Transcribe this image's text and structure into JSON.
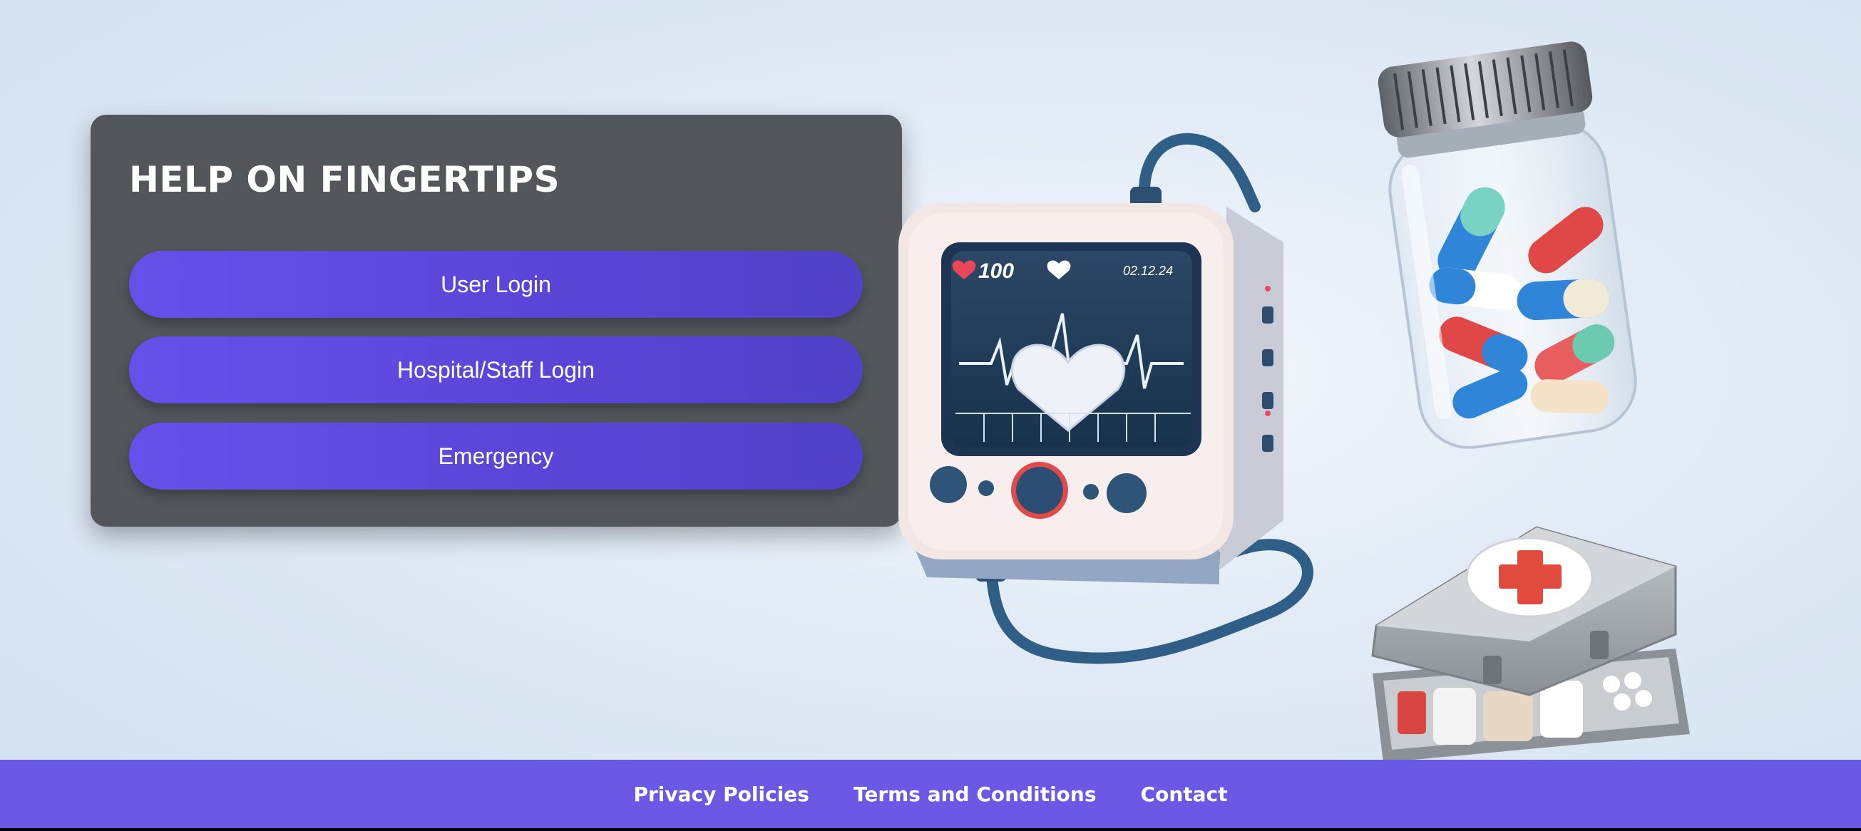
{
  "card": {
    "title": "HELP ON FINGERTIPS",
    "buttons": {
      "user_login": "User Login",
      "staff_login": "Hospital/Staff Login",
      "emergency": "Emergency"
    }
  },
  "illustration": {
    "monitor": {
      "heart_rate": "100",
      "date": "02.12.24"
    },
    "icons": [
      "heart-monitor-icon",
      "pill-bottle-icon",
      "first-aid-kit-icon"
    ]
  },
  "footer": {
    "links": {
      "privacy": "Privacy Policies",
      "terms": "Terms and Conditions",
      "contact": "Contact"
    }
  },
  "colors": {
    "accent": "#6b59e6",
    "button": "#5b45d8",
    "card": "#53575b",
    "background": "#dfe8f4"
  }
}
